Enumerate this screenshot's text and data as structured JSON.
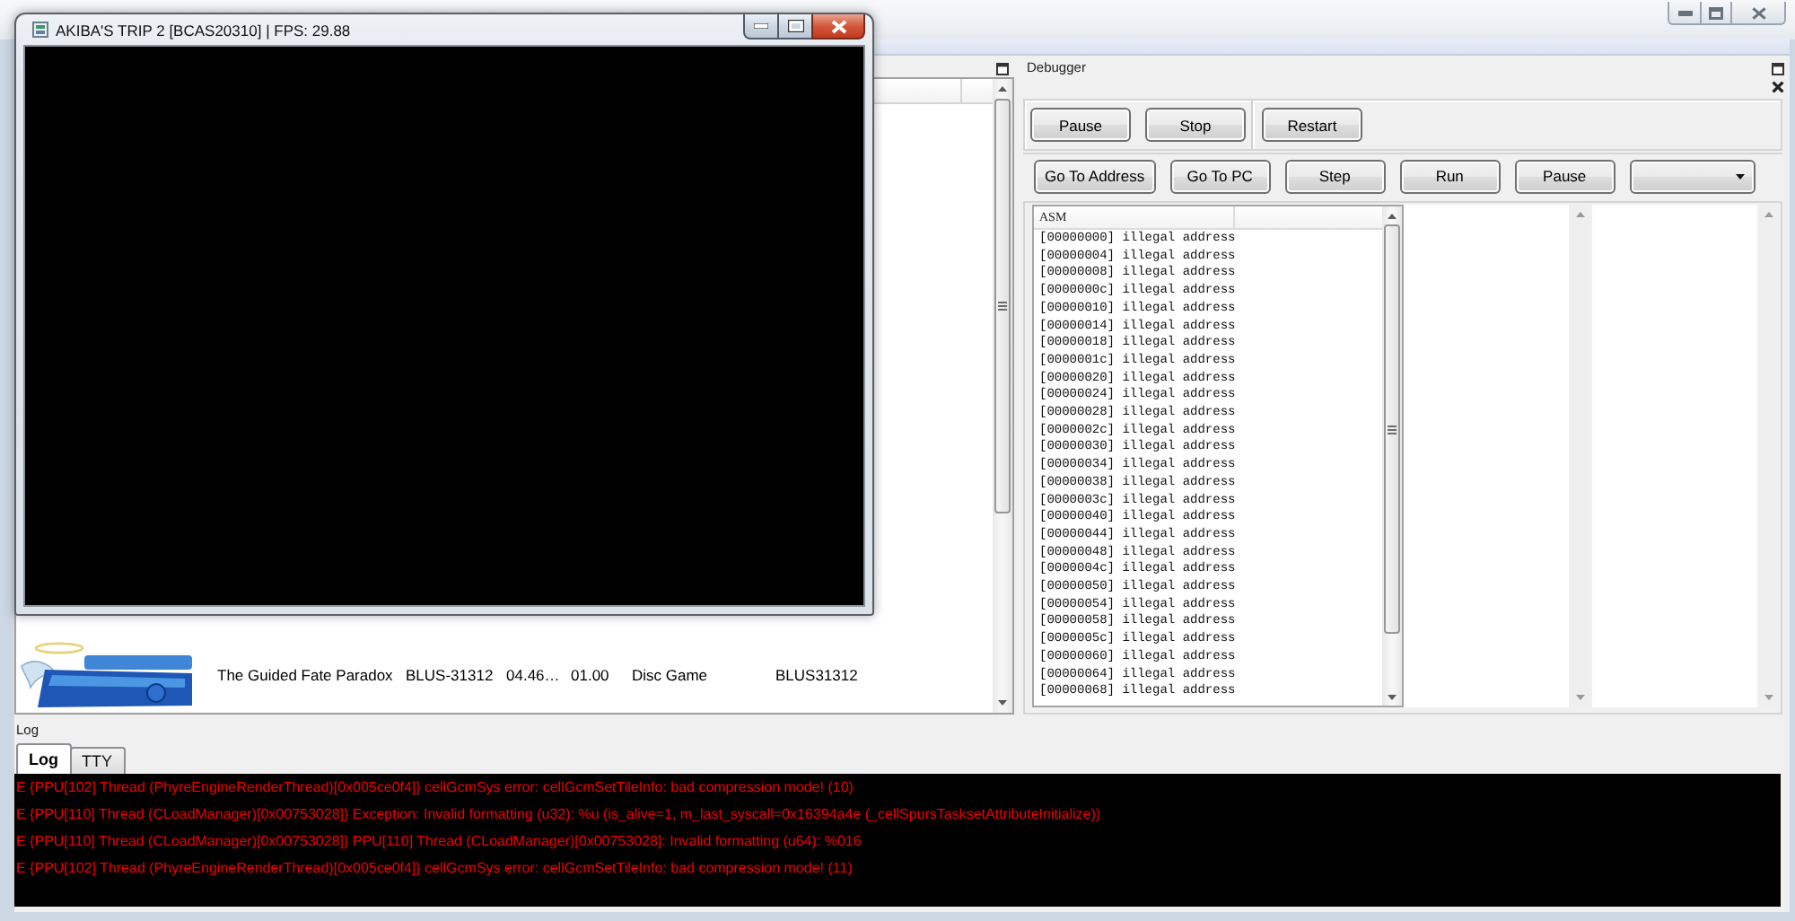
{
  "game_window": {
    "title": "AKIBA'S TRIP 2 [BCAS20310] | FPS: 29.88"
  },
  "game_list": {
    "rows": [
      {
        "cells": [
          "The Guided Fate Paradox",
          "BLUS-31312",
          "04.46…",
          "01.00",
          "Disc Game",
          "BLUS31312"
        ]
      }
    ]
  },
  "debugger": {
    "title": "Debugger",
    "toolbar_groups": [
      [
        "Pause",
        "Stop"
      ],
      [
        "Restart"
      ]
    ],
    "nav_buttons": [
      "Go To Address",
      "Go To PC",
      "Step",
      "Run",
      "Pause"
    ],
    "asm": {
      "column": "ASM",
      "lines": [
        "[00000000] illegal address",
        "[00000004] illegal address",
        "[00000008] illegal address",
        "[0000000c] illegal address",
        "[00000010] illegal address",
        "[00000014] illegal address",
        "[00000018] illegal address",
        "[0000001c] illegal address",
        "[00000020] illegal address",
        "[00000024] illegal address",
        "[00000028] illegal address",
        "[0000002c] illegal address",
        "[00000030] illegal address",
        "[00000034] illegal address",
        "[00000038] illegal address",
        "[0000003c] illegal address",
        "[00000040] illegal address",
        "[00000044] illegal address",
        "[00000048] illegal address",
        "[0000004c] illegal address",
        "[00000050] illegal address",
        "[00000054] illegal address",
        "[00000058] illegal address",
        "[0000005c] illegal address",
        "[00000060] illegal address",
        "[00000064] illegal address",
        "[00000068] illegal address"
      ]
    }
  },
  "log": {
    "title": "Log",
    "tabs": [
      {
        "label": "Log",
        "selected": true
      },
      {
        "label": "TTY",
        "selected": false
      }
    ],
    "lines": [
      "E {PPU[102] Thread (PhyreEngineRenderThread)[0x005ce0f4]} cellGcmSys error: cellGcmSetTileInfo: bad compression mode! (10)",
      "E {PPU[110] Thread (CLoadManager)[0x00753028]} Exception: Invalid formatting (u32): %u (is_alive=1, m_last_syscall=0x16394a4e (_cellSpursTasksetAttributeInitialize))",
      "E {PPU[110] Thread (CLoadManager)[0x00753028]} PPU[110] Thread (CLoadManager)[0x00753028]: Invalid formatting (u64): %016",
      "E {PPU[102] Thread (PhyreEngineRenderThread)[0x005ce0f4]} cellGcmSys error: cellGcmSetTileInfo: bad compression mode! (11)"
    ]
  }
}
